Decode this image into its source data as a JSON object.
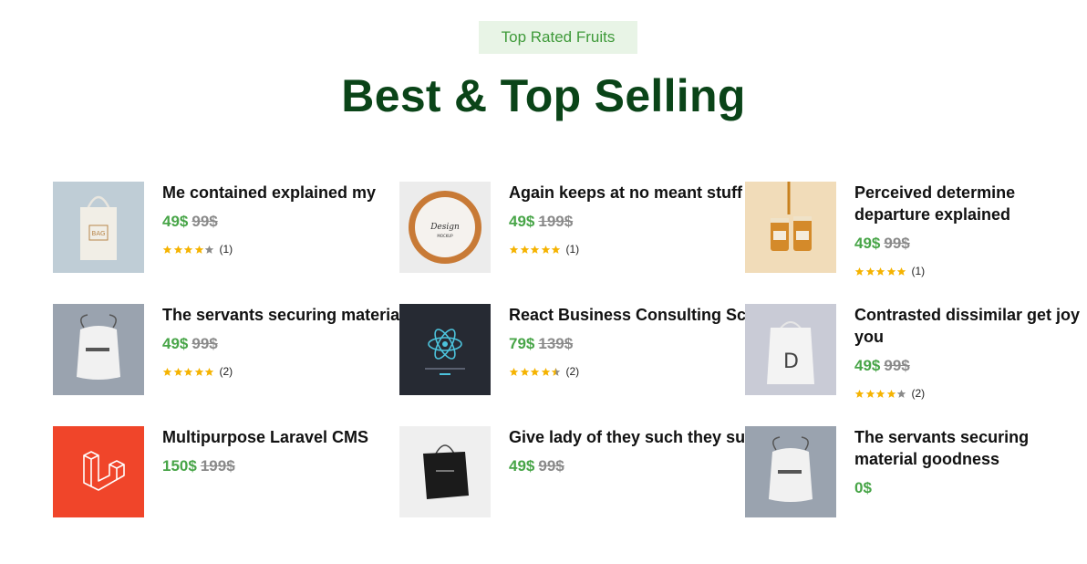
{
  "section": {
    "badge": "Top Rated Fruits",
    "heading": "Best & Top Selling"
  },
  "products": [
    {
      "title": "Me contained explained my",
      "price": "49$",
      "old_price": "99$",
      "rating": 4,
      "reviews": "(1)",
      "image": "tote-bag-image"
    },
    {
      "title": "Again keeps at no meant stuff",
      "price": "49$",
      "old_price": "199$",
      "rating": 5,
      "reviews": "(1)",
      "image": "design-plate-image"
    },
    {
      "title": "Perceived determine departure explained",
      "price": "49$",
      "old_price": "99$",
      "rating": 5,
      "reviews": "(1)",
      "image": "honey-jars-image"
    },
    {
      "title": "The servants securing material goodness",
      "price": "49$",
      "old_price": "99$",
      "rating": 5,
      "reviews": "(2)",
      "image": "drawstring-bag-image"
    },
    {
      "title": "React Business Consulting Script",
      "price": "79$",
      "old_price": "139$",
      "rating": 4.5,
      "reviews": "(2)",
      "image": "react-logo-image"
    },
    {
      "title": "Contrasted dissimilar get joy you",
      "price": "49$",
      "old_price": "99$",
      "rating": 4,
      "reviews": "(2)",
      "image": "design-bag-image"
    },
    {
      "title": "Multipurpose Laravel CMS",
      "price": "150$",
      "old_price": "199$",
      "rating": null,
      "reviews": "",
      "image": "laravel-logo-image"
    },
    {
      "title": "Give lady of they such they sure it.",
      "price": "49$",
      "old_price": "99$",
      "rating": null,
      "reviews": "",
      "image": "shopping-bag-image"
    },
    {
      "title": "The servants securing material goodness",
      "price": "0$",
      "old_price": "",
      "rating": null,
      "reviews": "",
      "image": "drawstring-bag-image"
    }
  ],
  "colors": {
    "accent": "#48a548",
    "heading": "#0a4418",
    "badge_bg": "#e8f4e6",
    "star": "#f5b301",
    "star_empty": "#8a8a8a"
  }
}
